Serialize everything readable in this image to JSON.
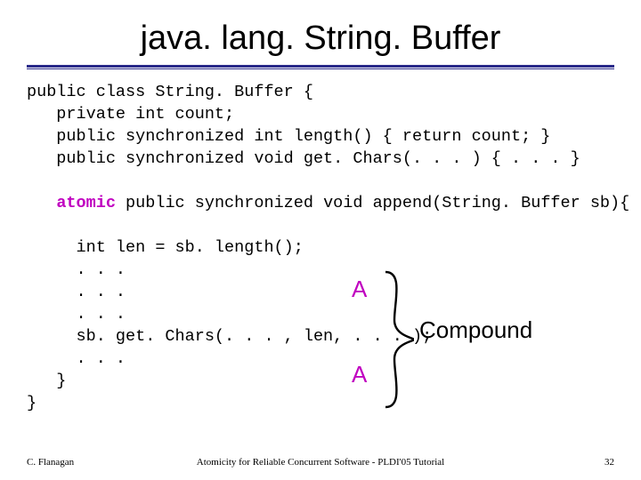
{
  "title": "java. lang. String. Buffer",
  "code": {
    "line1": "public class String. Buffer {",
    "line2": "   private int count;",
    "line3": "   public synchronized int length() { return count; }",
    "line4": "   public synchronized void get. Chars(. . . ) { . . . }",
    "line5a": "   ",
    "line5b": "atomic",
    "line5c": " public synchronized void append(String. Buffer sb){",
    "line6": "     int len = sb. length();",
    "line7": "     . . .",
    "line8": "     . . .",
    "line9": "     . . .",
    "line10": "     sb. get. Chars(. . . , len, . . . );",
    "line11": "     . . .",
    "line12": "   }",
    "line13": "}"
  },
  "annotations": {
    "A": "A",
    "compound": "Compound"
  },
  "footer": {
    "left": "C. Flanagan",
    "center": "Atomicity for Reliable Concurrent Software - PLDI'05 Tutorial",
    "right": "32"
  }
}
